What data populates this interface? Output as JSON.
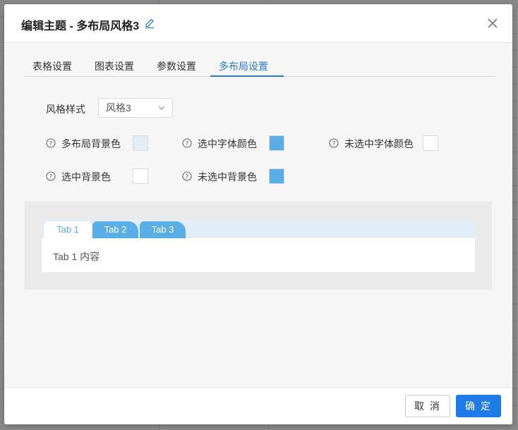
{
  "dialog": {
    "title": "编辑主题 - 多布局风格3",
    "close_icon": "close-icon",
    "edit_icon": "pencil-icon"
  },
  "tabs": [
    {
      "label": "表格设置",
      "active": false
    },
    {
      "label": "图表设置",
      "active": false
    },
    {
      "label": "参数设置",
      "active": false
    },
    {
      "label": "多布局设置",
      "active": true
    }
  ],
  "form": {
    "style_label": "风格样式",
    "style_value": "风格3",
    "colors": [
      {
        "label": "多布局背景色",
        "color": "#e1eef8"
      },
      {
        "label": "选中字体颜色",
        "color": "#5aaee8"
      },
      {
        "label": "未选中字体颜色",
        "color": "#ffffff"
      },
      {
        "label": "选中背景色",
        "color": "#ffffff"
      },
      {
        "label": "未选中背景色",
        "color": "#5aaee8"
      }
    ]
  },
  "preview": {
    "tabs": [
      "Tab 1",
      "Tab 2",
      "Tab 3"
    ],
    "content": "Tab 1 内容"
  },
  "footer": {
    "cancel_label": "取 消",
    "ok_label": "确 定"
  },
  "colors": {
    "accent": "#1f7be7",
    "tab_active": "#2a7bd8"
  }
}
